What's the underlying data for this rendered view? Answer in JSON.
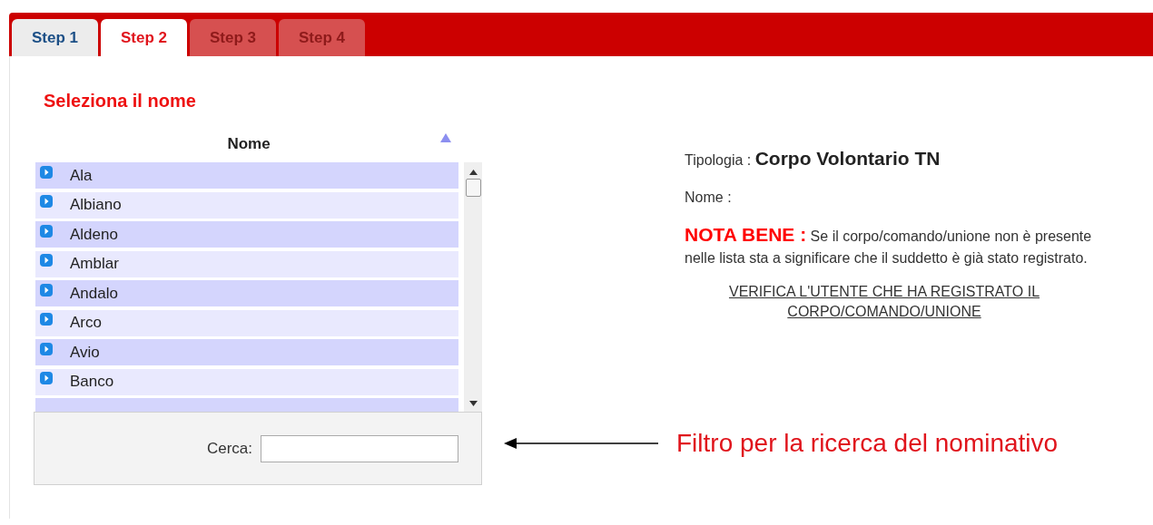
{
  "tabs": [
    {
      "label": "Step 1",
      "selected": false,
      "disabled": false
    },
    {
      "label": "Step 2",
      "selected": true,
      "disabled": false
    },
    {
      "label": "Step 3",
      "selected": false,
      "disabled": true
    },
    {
      "label": "Step 4",
      "selected": false,
      "disabled": true
    }
  ],
  "heading": "Seleziona il nome",
  "table": {
    "column": "Nome",
    "rows": [
      "Ala",
      "Albiano",
      "Aldeno",
      "Amblar",
      "Andalo",
      "Arco",
      "Avio",
      "Banco"
    ]
  },
  "search": {
    "label": "Cerca:"
  },
  "info": {
    "type_label": "Tipologia :",
    "type_value": "Corpo Volontario TN",
    "name_label": "Nome :",
    "note_label": "NOTA BENE :",
    "note_text": "Se il corpo/comando/unione non è presente nelle lista sta a significare che il suddetto è già stato registrato.",
    "link": "VERIFICA L'UTENTE CHE HA REGISTRATO IL CORPO/COMANDO/UNIONE"
  },
  "annotation": "Filtro per la ricerca del nominativo"
}
